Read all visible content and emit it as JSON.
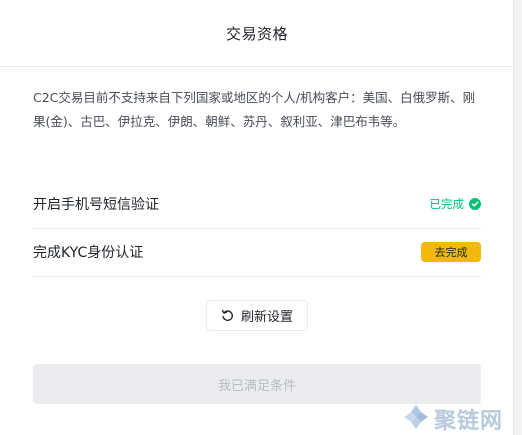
{
  "dialog": {
    "title": "交易资格",
    "notice": "C2C交易目前不支持来自下列国家或地区的个人/机构客户：美国、白俄罗斯、刚果(金)、古巴、伊拉克、伊朗、朝鲜、苏丹、叙利亚、津巴布韦等。"
  },
  "requirements": [
    {
      "label": "开启手机号短信验证",
      "status": "已完成",
      "completed": true
    },
    {
      "label": "完成KYC身份认证",
      "action": "去完成",
      "completed": false
    }
  ],
  "refresh_button": {
    "label": "刷新设置",
    "icon": "refresh-icon"
  },
  "confirm_button": {
    "label": "我已满足条件",
    "enabled": false
  },
  "watermark": {
    "text": "聚链网",
    "icon": "logo-icon"
  },
  "colors": {
    "accent": "#f0b90b",
    "success": "#02c076",
    "disabled_bg": "#eaecef",
    "disabled_text": "#b7bdc6"
  }
}
